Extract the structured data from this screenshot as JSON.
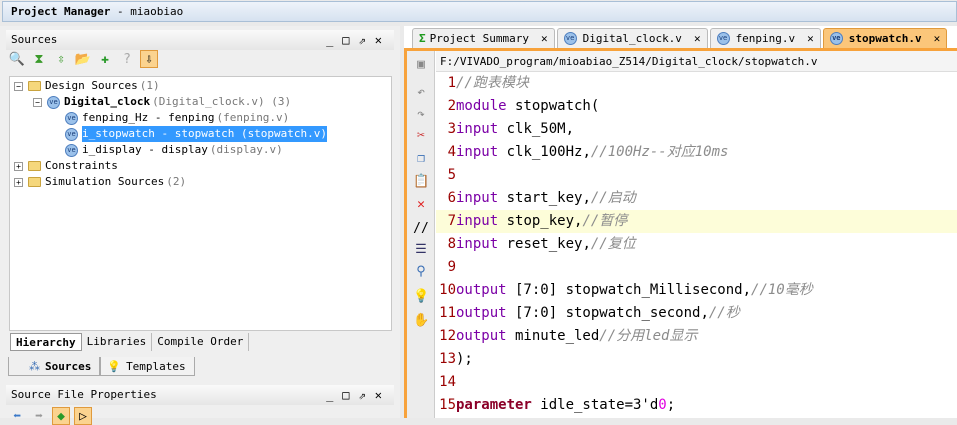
{
  "window": {
    "title": "Project Manager",
    "project": "miaobiao",
    "separator": " - "
  },
  "sources_panel": {
    "title": "Sources",
    "window_buttons": [
      "_",
      "□",
      "⇗",
      "✕"
    ],
    "tree": [
      {
        "label": "Design Sources",
        "suffix": "(1)"
      },
      {
        "label": "Digital_clock",
        "suffix": "(Digital_clock.v) (3)"
      },
      {
        "label": "fenping_Hz - fenping",
        "suffix": "(fenping.v)"
      },
      {
        "label": "i_stopwatch - stopwatch (stopwatch.v)",
        "suffix": ""
      },
      {
        "label": "i_display - display",
        "suffix": "(display.v)"
      },
      {
        "label": "Constraints",
        "suffix": ""
      },
      {
        "label": "Simulation Sources",
        "suffix": "(2)"
      }
    ],
    "sub_tabs": [
      "Hierarchy",
      "Libraries",
      "Compile Order"
    ],
    "outer_tabs": [
      "Sources",
      "Templates"
    ]
  },
  "properties_panel": {
    "title": "Source File Properties"
  },
  "editor": {
    "tabs": [
      "Project Summary",
      "Digital_clock.v",
      "fenping.v",
      "stopwatch.v"
    ],
    "path": "F:/VIVADO_program/mioabiao_Z514/Digital_clock/stopwatch.v",
    "lines": [
      {
        "n": "1",
        "kw": "",
        "code": "",
        "cm": "//跑表模块"
      },
      {
        "n": "2",
        "kw": "module",
        "code": " stopwatch(",
        "cm": ""
      },
      {
        "n": "3",
        "kw": "input",
        "code": " clk_50M,",
        "cm": ""
      },
      {
        "n": "4",
        "kw": "input",
        "code": " clk_100Hz,",
        "cm": "//100Hz--对应10ms"
      },
      {
        "n": "5",
        "kw": "",
        "code": "",
        "cm": ""
      },
      {
        "n": "6",
        "kw": "input",
        "code": " start_key,",
        "cm": "//启动"
      },
      {
        "n": "7",
        "kw": "input",
        "code": " stop_key,",
        "cm": "//暂停"
      },
      {
        "n": "8",
        "kw": "input",
        "code": " reset_key,",
        "cm": "//复位"
      },
      {
        "n": "9",
        "kw": "",
        "code": "",
        "cm": ""
      },
      {
        "n": "10",
        "kw": "output",
        "code": " [7:0] stopwatch_Millisecond,",
        "cm": "//10毫秒"
      },
      {
        "n": "11",
        "kw": "output",
        "code": " [7:0] stopwatch_second,",
        "cm": "//秒"
      },
      {
        "n": "12",
        "kw": "output",
        "code": " minute_led",
        "cm": "//分用led显示"
      },
      {
        "n": "13",
        "kw": "",
        "code": ");",
        "cm": ""
      },
      {
        "n": "14",
        "kw": "",
        "code": "",
        "cm": ""
      },
      {
        "n": "15",
        "kw": "parameter",
        "code": " idle_state=3'd",
        "num": "0",
        "tail": ";",
        "cm": ""
      }
    ]
  }
}
